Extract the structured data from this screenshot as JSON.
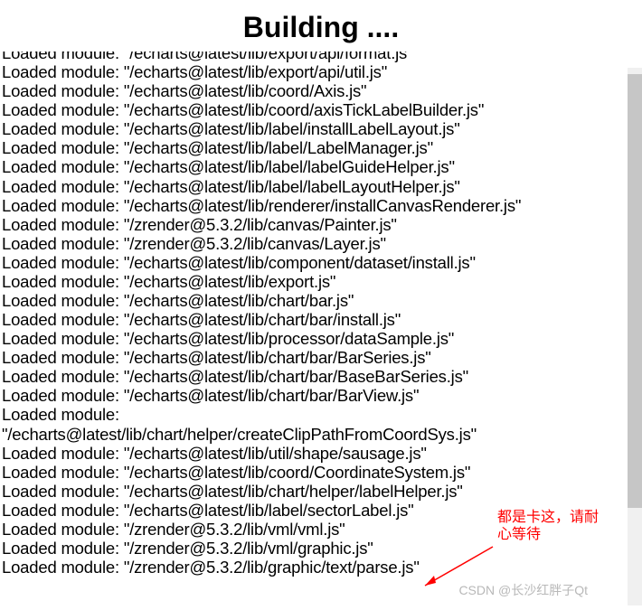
{
  "title": "Building ....",
  "log_prefix": "Loaded module: ",
  "logs": [
    "\"/echarts@latest/lib/export/api/format.js\"",
    "\"/echarts@latest/lib/export/api/util.js\"",
    "\"/echarts@latest/lib/coord/Axis.js\"",
    "\"/echarts@latest/lib/coord/axisTickLabelBuilder.js\"",
    "\"/echarts@latest/lib/label/installLabelLayout.js\"",
    "\"/echarts@latest/lib/label/LabelManager.js\"",
    "\"/echarts@latest/lib/label/labelGuideHelper.js\"",
    "\"/echarts@latest/lib/label/labelLayoutHelper.js\"",
    "\"/echarts@latest/lib/renderer/installCanvasRenderer.js\"",
    "\"/zrender@5.3.2/lib/canvas/Painter.js\"",
    "\"/zrender@5.3.2/lib/canvas/Layer.js\"",
    "\"/echarts@latest/lib/component/dataset/install.js\"",
    "\"/echarts@latest/lib/export.js\"",
    "\"/echarts@latest/lib/chart/bar.js\"",
    "\"/echarts@latest/lib/chart/bar/install.js\"",
    "\"/echarts@latest/lib/processor/dataSample.js\"",
    "\"/echarts@latest/lib/chart/bar/BarSeries.js\"",
    "\"/echarts@latest/lib/chart/bar/BaseBarSeries.js\"",
    "\"/echarts@latest/lib/chart/bar/BarView.js\""
  ],
  "log_split_prefix": "Loaded module:",
  "log_split_path": "\"/echarts@latest/lib/chart/helper/createClipPathFromCoordSys.js\"",
  "logs_after": [
    "\"/echarts@latest/lib/util/shape/sausage.js\"",
    "\"/echarts@latest/lib/coord/CoordinateSystem.js\"",
    "\"/echarts@latest/lib/chart/helper/labelHelper.js\"",
    "\"/echarts@latest/lib/label/sectorLabel.js\"",
    "\"/zrender@5.3.2/lib/vml/vml.js\"",
    "\"/zrender@5.3.2/lib/vml/graphic.js\"",
    "\"/zrender@5.3.2/lib/graphic/text/parse.js\""
  ],
  "annotation_line1": "都是卡这，请耐",
  "annotation_line2": "心等待",
  "watermark": "CSDN @长沙红胖子Qt"
}
